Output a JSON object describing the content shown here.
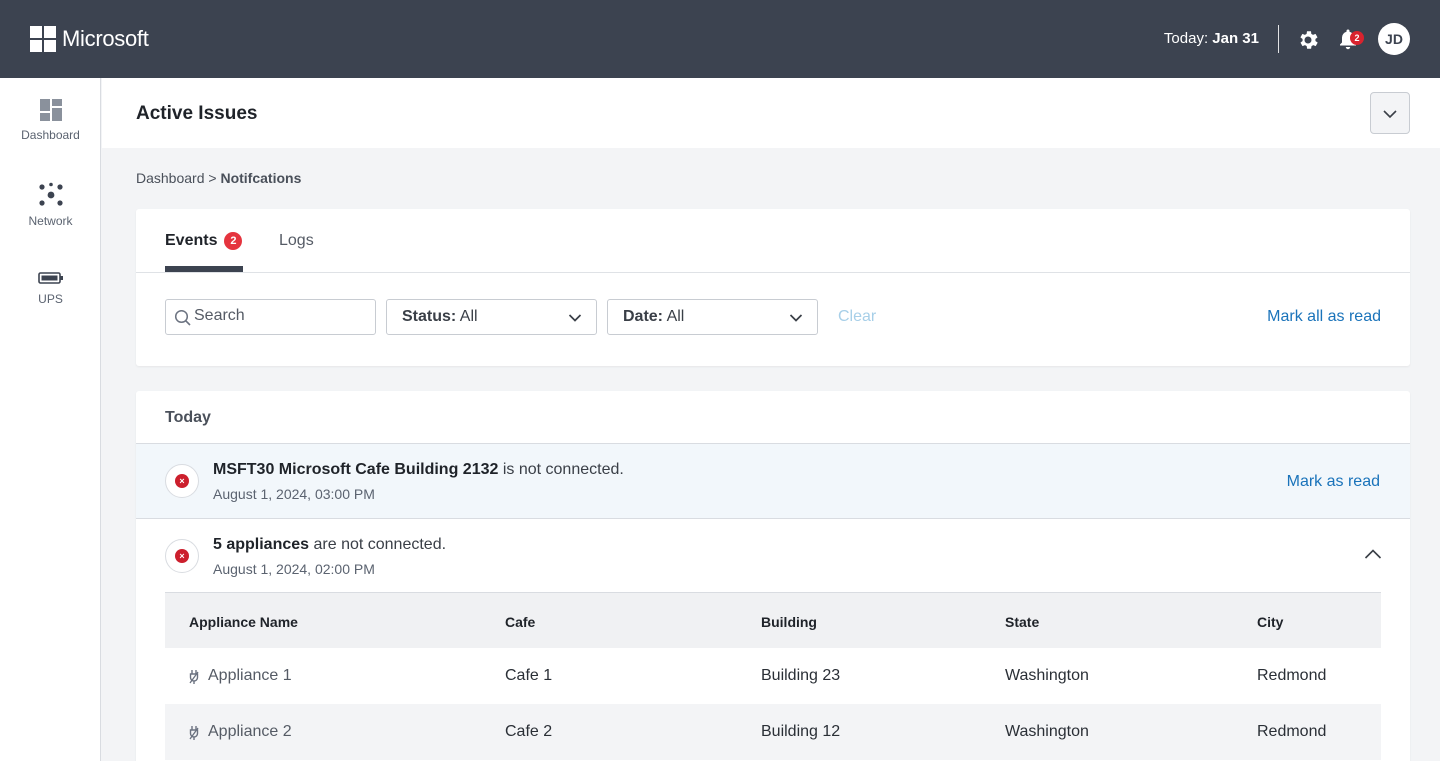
{
  "header": {
    "brand": "Microsoft",
    "today_label": "Today:",
    "today_value": "Jan 31",
    "notification_count": "2",
    "avatar_initials": "JD"
  },
  "sidebar": {
    "items": [
      {
        "label": "Dashboard",
        "icon": "dashboard-icon"
      },
      {
        "label": "Network",
        "icon": "network-icon"
      },
      {
        "label": "UPS",
        "icon": "battery-icon"
      }
    ]
  },
  "page": {
    "title": "Active Issues"
  },
  "breadcrumb": {
    "root": "Dashboard",
    "separator": ">",
    "current": "Notifcations"
  },
  "tabs": {
    "events": "Events",
    "events_badge": "2",
    "logs": "Logs"
  },
  "filters": {
    "search_placeholder": "Search",
    "status_label": "Status:",
    "status_value": "All",
    "date_label": "Date:",
    "date_value": "All",
    "clear": "Clear",
    "mark_all": "Mark all as read"
  },
  "events": {
    "section": "Today",
    "items": [
      {
        "subject": "MSFT30 Microsoft Cafe Building 2132",
        "message": "is not connected.",
        "time": "August 1, 2024, 03:00 PM",
        "action": "Mark as read"
      },
      {
        "subject": "5 appliances",
        "message": "are not connected.",
        "time": "August 1, 2024, 02:00 PM"
      }
    ]
  },
  "table": {
    "columns": [
      "Appliance Name",
      "Cafe",
      "Building",
      "State",
      "City"
    ],
    "rows": [
      [
        "Appliance 1",
        "Cafe 1",
        "Building 23",
        "Washington",
        "Redmond"
      ],
      [
        "Appliance 2",
        "Cafe 2",
        "Building 12",
        "Washington",
        "Redmond"
      ]
    ]
  },
  "colors": {
    "topbar": "#3c4350",
    "accent_link": "#1a73ba",
    "error": "#cc1f2d",
    "badge": "#e5343e"
  }
}
